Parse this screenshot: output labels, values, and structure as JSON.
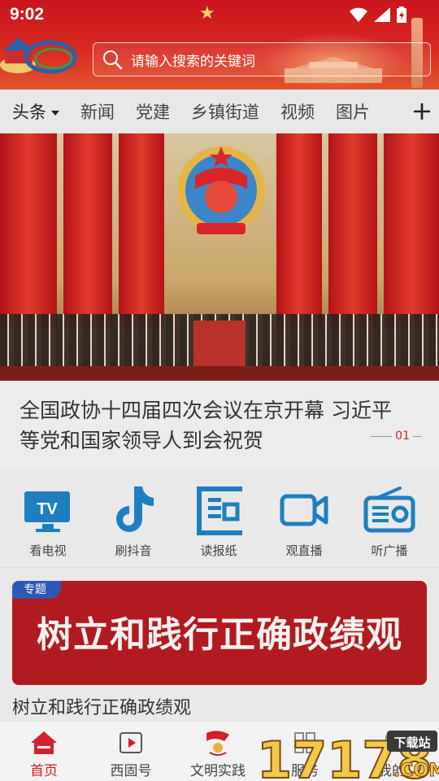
{
  "status_bar": {
    "time": "9:02"
  },
  "search": {
    "placeholder": "请输入搜索的关键词"
  },
  "tabs": [
    {
      "label": "头条"
    },
    {
      "label": "新闻"
    },
    {
      "label": "党建"
    },
    {
      "label": "乡镇街道"
    },
    {
      "label": "视频"
    },
    {
      "label": "图片"
    }
  ],
  "banner": {
    "title": "全国政协十四届四次会议在京开幕 习近平等党和国家领导人到会祝贺",
    "page": "01"
  },
  "quick_links": [
    {
      "label": "看电视",
      "icon": "tv-icon"
    },
    {
      "label": "刷抖音",
      "icon": "tiktok-icon"
    },
    {
      "label": "读报纸",
      "icon": "newspaper-icon"
    },
    {
      "label": "观直播",
      "icon": "video-camera-icon"
    },
    {
      "label": "听广播",
      "icon": "radio-icon"
    }
  ],
  "special": {
    "badge": "专题",
    "headline": "树立和践行正确政绩观",
    "caption": "树立和践行正确政绩观"
  },
  "bottom_nav": [
    {
      "label": "首页",
      "icon": "home-icon",
      "active": true
    },
    {
      "label": "西固号",
      "icon": "play-icon"
    },
    {
      "label": "文明实践",
      "icon": "flag-icon"
    },
    {
      "label": "服务",
      "icon": "grid-icon"
    },
    {
      "label": "我的",
      "icon": "user-icon"
    }
  ],
  "watermark": {
    "text": "17178",
    "tag": "下载站",
    "suffix": ".COM"
  },
  "colors": {
    "accent": "#d3202a",
    "icon_blue": "#1e7fc0",
    "header_red": "#c8141c"
  }
}
